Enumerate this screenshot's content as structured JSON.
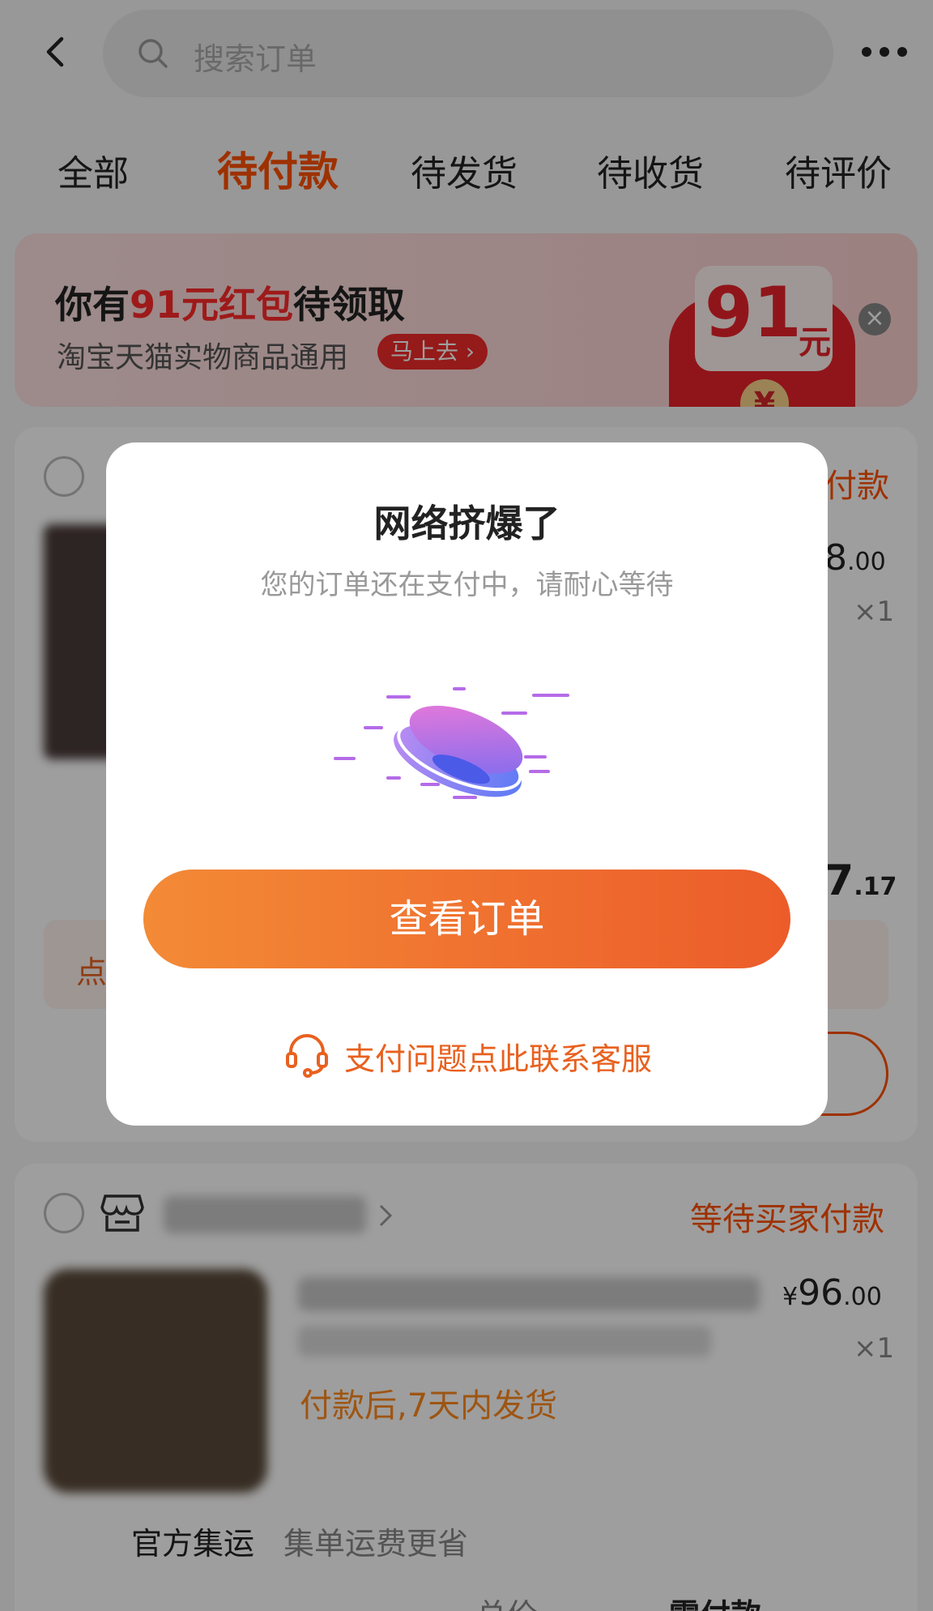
{
  "header": {
    "search_placeholder": "搜索订单"
  },
  "tabs": [
    {
      "label": "全部",
      "active": false
    },
    {
      "label": "待付款",
      "active": true
    },
    {
      "label": "待发货",
      "active": false
    },
    {
      "label": "待收货",
      "active": false
    },
    {
      "label": "待评价",
      "active": false
    }
  ],
  "banner": {
    "title_prefix": "你有",
    "title_highlight": "91元红包",
    "title_suffix": "待领取",
    "subtitle": "淘宝天猫实物商品通用",
    "go_label": "马上去 ›",
    "packet_amount": "91",
    "packet_unit": "元",
    "packet_symbol": "¥"
  },
  "order1": {
    "status": "付款",
    "price_main": "8",
    "price_dec": ".00",
    "qty": "×1",
    "total_main": "7",
    "total_dec": ".17",
    "tip_prefix": "点"
  },
  "order2": {
    "status": "等待买家付款",
    "price_symbol": "¥",
    "price_main": "96",
    "price_dec": ".00",
    "qty": "×1",
    "ship_note": "付款后,7天内发货",
    "logistics_label": "官方集运",
    "logistics_note": "集单运费更省",
    "total_label": "总价",
    "pay_label": "需付款"
  },
  "modal": {
    "title": "网络挤爆了",
    "message": "您的订单还在支付中，请耐心等待",
    "primary_button": "查看订单",
    "service_link": "支付问题点此联系客服"
  },
  "colors": {
    "accent": "#ff5000",
    "button_start": "#f38a36",
    "button_end": "#ec5c2a",
    "service": "#e8611f"
  }
}
